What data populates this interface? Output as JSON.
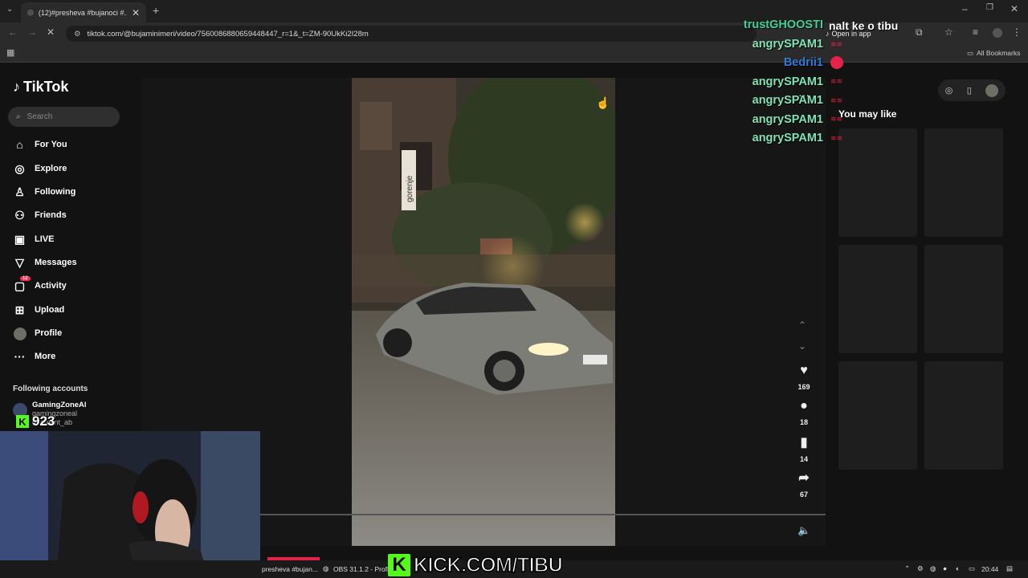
{
  "browser": {
    "tab_title": "(12)#presheva #bujanoci #...",
    "url": "tiktok.com/@bujaminimeri/video/7560086880659448447_r=1&_t=ZM-90UkKi2I28m",
    "open_in_app": "Open in app",
    "all_bookmarks": "All Bookmarks"
  },
  "tiktok": {
    "logo": "TikTok",
    "search_placeholder": "Search",
    "nav": [
      {
        "label": "For You",
        "icon": "home-icon"
      },
      {
        "label": "Explore",
        "icon": "compass-icon"
      },
      {
        "label": "Following",
        "icon": "following-icon"
      },
      {
        "label": "Friends",
        "icon": "friends-icon"
      },
      {
        "label": "LIVE",
        "icon": "live-icon"
      },
      {
        "label": "Messages",
        "icon": "messages-icon"
      },
      {
        "label": "Activity",
        "icon": "activity-icon",
        "badge": "12"
      },
      {
        "label": "Upload",
        "icon": "upload-icon"
      },
      {
        "label": "Profile",
        "icon": "avatar"
      },
      {
        "label": "More",
        "icon": "more-icon"
      }
    ],
    "following_accounts_title": "Following accounts",
    "following_accounts": [
      {
        "name": "GamingZoneAl",
        "handle": "gamingzoneal"
      },
      {
        "name": "",
        "handle": "d1amant_ab"
      }
    ],
    "actions": {
      "likes": "169",
      "comments": "18",
      "saves": "14",
      "shares": "67"
    },
    "you_may_like": "You may like",
    "video_sign_text": "gorenje"
  },
  "chat": [
    {
      "user": "trustGHOOSTI",
      "color": "#3fd19a",
      "message": "nalt ke o tibu"
    },
    {
      "user": "angrySPAM1",
      "color": "#7fe3b4",
      "message": ""
    },
    {
      "user": "Bedrii1",
      "color": "#2f7bd6",
      "message": ""
    },
    {
      "user": "angrySPAM1",
      "color": "#7fe3b4",
      "message": ""
    },
    {
      "user": "angrySPAM1",
      "color": "#7fe3b4",
      "message": ""
    },
    {
      "user": "angrySPAM1",
      "color": "#7fe3b4",
      "message": ""
    },
    {
      "user": "angrySPAM1",
      "color": "#7fe3b4",
      "message": ""
    }
  ],
  "stream": {
    "kick_url": "KICK.COM/TIBU",
    "viewer_count": "923",
    "brand_color": "#53fc18"
  },
  "taskbar": {
    "item1": "presheva #bujan...",
    "item2": "OBS 31.1.2 - Profile",
    "time": "20:44"
  }
}
